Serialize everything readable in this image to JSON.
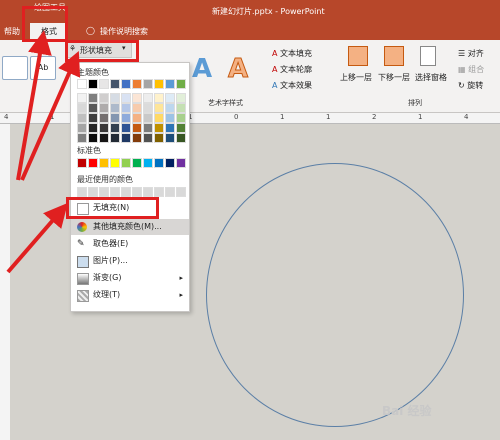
{
  "titlebar": {
    "context_tools": "绘图工具",
    "doc_title": "新建幻灯片.pptx  -  PowerPoint"
  },
  "tabs": {
    "help": "帮助",
    "format": "格式",
    "search": "操作说明搜索"
  },
  "ribbon": {
    "shape_fill": "形状填充",
    "text_fill": "文本填充",
    "text_outline": "文本轮廓",
    "text_effects": "文本效果",
    "wordart_label": "艺术字样式",
    "bring_forward": "上移一层",
    "send_backward": "下移一层",
    "selection_pane": "选择窗格",
    "align": "对齐",
    "group": "组合",
    "rotate": "旋转",
    "arrange_label": "排列",
    "style_preview": "Ab"
  },
  "menu": {
    "theme_colors": "主题颜色",
    "standard_colors": "标准色",
    "recent_colors": "最近使用的颜色",
    "no_fill": "无填充(N)",
    "more_colors": "其他填充颜色(M)...",
    "eyedropper": "取色器(E)",
    "picture": "图片(P)...",
    "gradient": "渐变(G)",
    "texture": "纹理(T)"
  },
  "ruler": {
    "ticks": [
      "4",
      "1",
      "2",
      "1",
      "1",
      "0",
      "1",
      "1",
      "2",
      "1",
      "4"
    ]
  },
  "theme_palette": {
    "top_row": [
      "#ffffff",
      "#000000",
      "#e7e6e6",
      "#44546a",
      "#4472c4",
      "#ed7d31",
      "#a5a5a5",
      "#ffc000",
      "#5b9bd5",
      "#70ad47"
    ],
    "shades": [
      [
        "#f2f2f2",
        "#7f7f7f",
        "#d0cece",
        "#d6dce4",
        "#d9e2f3",
        "#fbe5d5",
        "#ededed",
        "#fff2cc",
        "#deebf6",
        "#e2efd9"
      ],
      [
        "#d8d8d8",
        "#595959",
        "#aeabab",
        "#adb9ca",
        "#b4c6e7",
        "#f7cbac",
        "#dbdbdb",
        "#fee599",
        "#bdd7ee",
        "#c5e0b3"
      ],
      [
        "#bfbfbf",
        "#3f3f3f",
        "#757070",
        "#8496b0",
        "#8eaadb",
        "#f4b183",
        "#c9c9c9",
        "#ffd965",
        "#9cc3e5",
        "#a8d08d"
      ],
      [
        "#a5a5a5",
        "#262626",
        "#3a3838",
        "#323f4f",
        "#2f5496",
        "#c55a11",
        "#7b7b7b",
        "#bf9000",
        "#2e75b5",
        "#538135"
      ],
      [
        "#7f7f7f",
        "#0c0c0c",
        "#171616",
        "#222a35",
        "#1f3864",
        "#833c0b",
        "#525252",
        "#7f6000",
        "#1e4e79",
        "#375623"
      ]
    ],
    "standard": [
      "#c00000",
      "#ff0000",
      "#ffc000",
      "#ffff00",
      "#92d050",
      "#00b050",
      "#00b0f0",
      "#0070c0",
      "#002060",
      "#7030a0"
    ],
    "recent": [
      "#d9d9d9",
      "#d9d9d9",
      "#d9d9d9",
      "#d9d9d9",
      "#d9d9d9",
      "#d9d9d9",
      "#d9d9d9",
      "#d9d9d9",
      "#d9d9d9",
      "#d9d9d9"
    ]
  },
  "watermark": "Bai 经验"
}
